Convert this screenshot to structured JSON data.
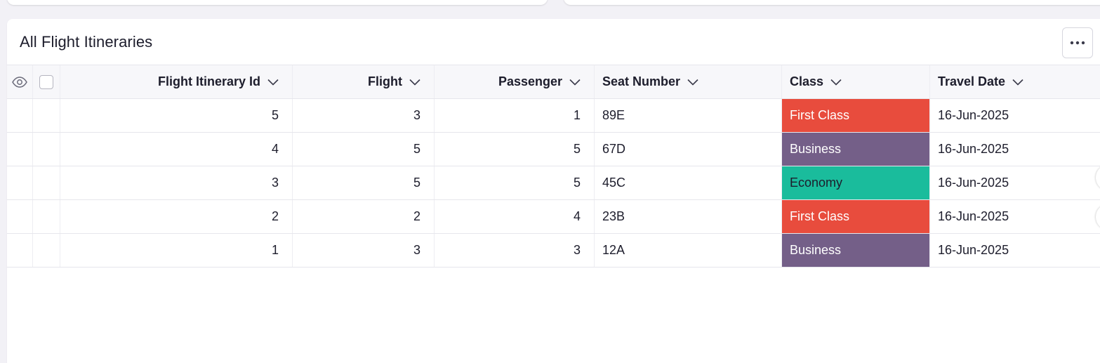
{
  "panel": {
    "title": "All Flight Itineraries"
  },
  "columns": {
    "id": "Flight Itinerary Id",
    "flight": "Flight",
    "passenger": "Passenger",
    "seat": "Seat Number",
    "class": "Class",
    "date": "Travel Date"
  },
  "class_colors": {
    "First Class": "#e84c3d",
    "Business": "#745f88",
    "Economy": "#1abc9c"
  },
  "rows": [
    {
      "id": "5",
      "flight": "3",
      "passenger": "1",
      "seat": "89E",
      "class": "First Class",
      "date": "16-Jun-2025"
    },
    {
      "id": "4",
      "flight": "5",
      "passenger": "5",
      "seat": "67D",
      "class": "Business",
      "date": "16-Jun-2025"
    },
    {
      "id": "3",
      "flight": "5",
      "passenger": "5",
      "seat": "45C",
      "class": "Economy",
      "date": "16-Jun-2025"
    },
    {
      "id": "2",
      "flight": "2",
      "passenger": "4",
      "seat": "23B",
      "class": "First Class",
      "date": "16-Jun-2025"
    },
    {
      "id": "1",
      "flight": "3",
      "passenger": "3",
      "seat": "12A",
      "class": "Business",
      "date": "16-Jun-2025"
    }
  ]
}
